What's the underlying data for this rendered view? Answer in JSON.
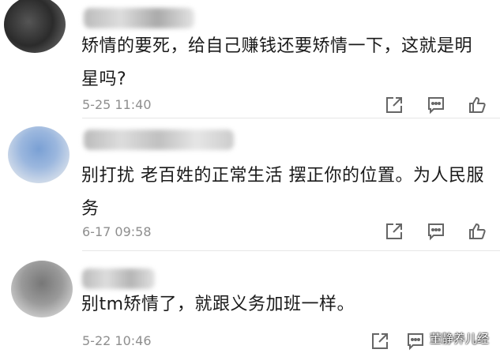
{
  "comments": [
    {
      "text": "矫情的要死，给自己赚钱还要矫情一下，这就是明星吗?",
      "time": "5-25 11:40"
    },
    {
      "text": "别打扰 老百姓的正常生活  摆正你的位置。为人民服务",
      "time": "6-17 09:58"
    },
    {
      "text": "别tm矫情了，就跟义务加班一样。",
      "time": "5-22 10:46"
    }
  ],
  "icons": {
    "share": "share-icon",
    "comment": "comment-icon",
    "like": "thumbs-up-icon"
  },
  "watermark": "董静养儿经"
}
